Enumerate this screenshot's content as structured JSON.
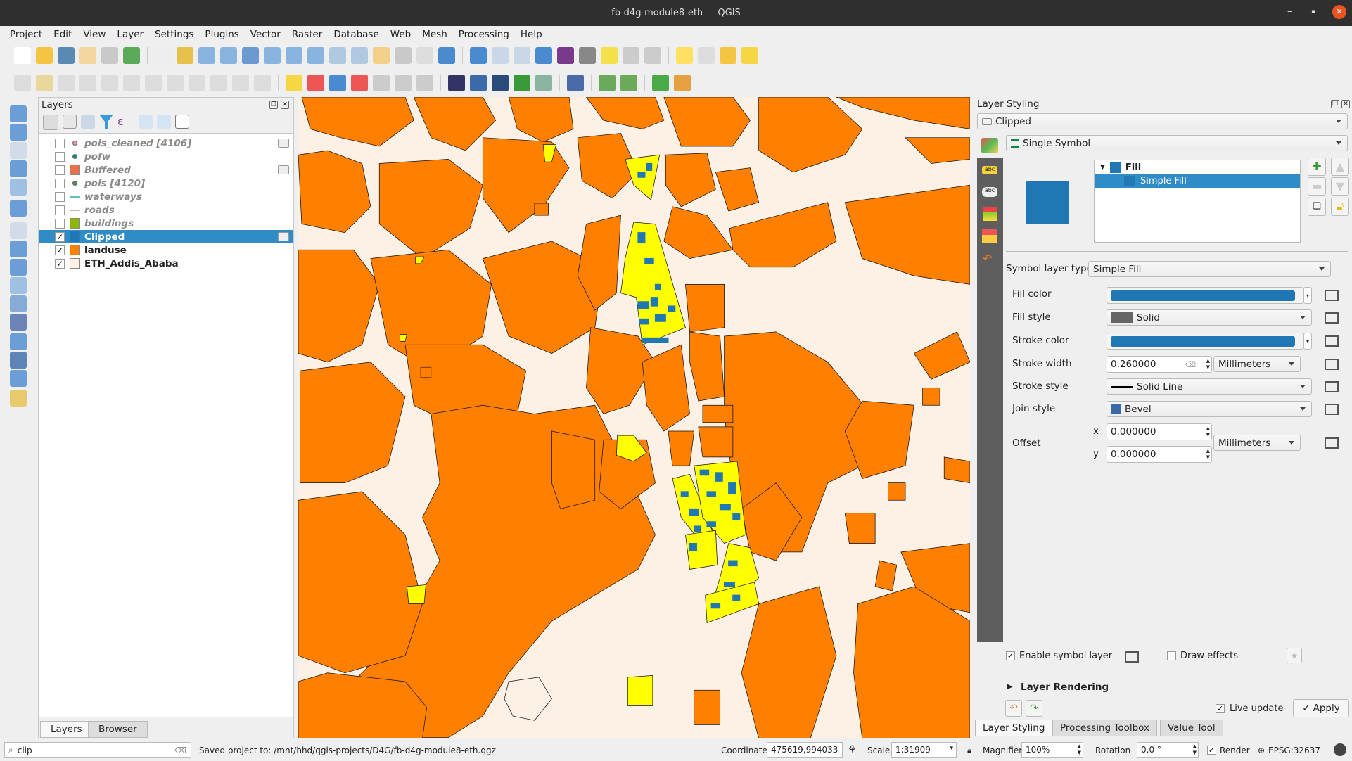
{
  "window": {
    "title": "fb-d4g-module8-eth — QGIS",
    "minimize": "–",
    "maximize": "▪",
    "close": "✕"
  },
  "menu": [
    "Project",
    "Edit",
    "View",
    "Layer",
    "Settings",
    "Plugins",
    "Vector",
    "Raster",
    "Database",
    "Web",
    "Mesh",
    "Processing",
    "Help"
  ],
  "layers_panel": {
    "title": "Layers",
    "tabs": [
      "Layers",
      "Browser"
    ],
    "items": [
      {
        "name": "pois_cleaned [4106]",
        "checked": false,
        "symbol": "point",
        "color": "#e89aa0"
      },
      {
        "name": "pofw",
        "checked": false,
        "symbol": "point",
        "color": "#1a8a8a"
      },
      {
        "name": "Buffered",
        "checked": false,
        "symbol": "fill",
        "color": "#e8724a"
      },
      {
        "name": "pois [4120]",
        "checked": false,
        "symbol": "point",
        "color": "#5a8a5a"
      },
      {
        "name": "waterways",
        "checked": false,
        "symbol": "line",
        "color": "#5fbfc8"
      },
      {
        "name": "roads",
        "checked": false,
        "symbol": "line",
        "color": "#bbbbbb"
      },
      {
        "name": "buildings",
        "checked": false,
        "symbol": "fill",
        "color": "#8db600"
      },
      {
        "name": "Clipped",
        "checked": true,
        "symbol": "fill",
        "color": "#1f78b4",
        "selected": true
      },
      {
        "name": "landuse",
        "checked": true,
        "symbol": "fill",
        "color": "#ff7f00"
      },
      {
        "name": "ETH_Addis_Ababa",
        "checked": true,
        "symbol": "fill",
        "color": "#fdf1e6"
      }
    ]
  },
  "styling": {
    "title": "Layer Styling",
    "layer": "Clipped",
    "renderer": "Single Symbol",
    "tree": {
      "root": "Fill",
      "child": "Simple Fill"
    },
    "symbol_layer_type_label": "Symbol layer type",
    "symbol_layer_type": "Simple Fill",
    "fill_color_label": "Fill color",
    "fill_color": "#1f78b4",
    "fill_style_label": "Fill style",
    "fill_style": "Solid",
    "stroke_color_label": "Stroke color",
    "stroke_color": "#1f78b4",
    "stroke_width_label": "Stroke width",
    "stroke_width": "0.260000",
    "stroke_width_unit": "Millimeters",
    "stroke_style_label": "Stroke style",
    "stroke_style": "Solid Line",
    "join_style_label": "Join style",
    "join_style": "Bevel",
    "offset_label": "Offset",
    "offset_x_label": "x",
    "offset_x": "0.000000",
    "offset_y_label": "y",
    "offset_y": "0.000000",
    "offset_unit": "Millimeters",
    "enable_symbol_layer": "Enable symbol layer",
    "enable_checked": true,
    "draw_effects": "Draw effects",
    "draw_effects_checked": false,
    "layer_rendering": "Layer Rendering",
    "live_update": "Live update",
    "live_checked": true,
    "apply": "Apply",
    "tabs": [
      "Layer Styling",
      "Processing Toolbox",
      "Value Tool"
    ]
  },
  "map_colors": {
    "background": "#fdf1e6",
    "landuse": "#ff7f00",
    "buildings": "#ffff00",
    "clipped": "#1f78b4"
  },
  "status": {
    "search": "clip",
    "message": "Saved project to: /mnt/hhd/qgis-projects/D4G/fb-d4g-module8-eth.qgz",
    "coordinate_label": "Coordinate",
    "coordinate": "475619,994033",
    "scale_label": "Scale",
    "scale": "1:31909",
    "magnifier_label": "Magnifier",
    "magnifier": "100%",
    "rotation_label": "Rotation",
    "rotation": "0.0 °",
    "render_label": "Render",
    "render_checked": true,
    "crs": "EPSG:32637"
  }
}
